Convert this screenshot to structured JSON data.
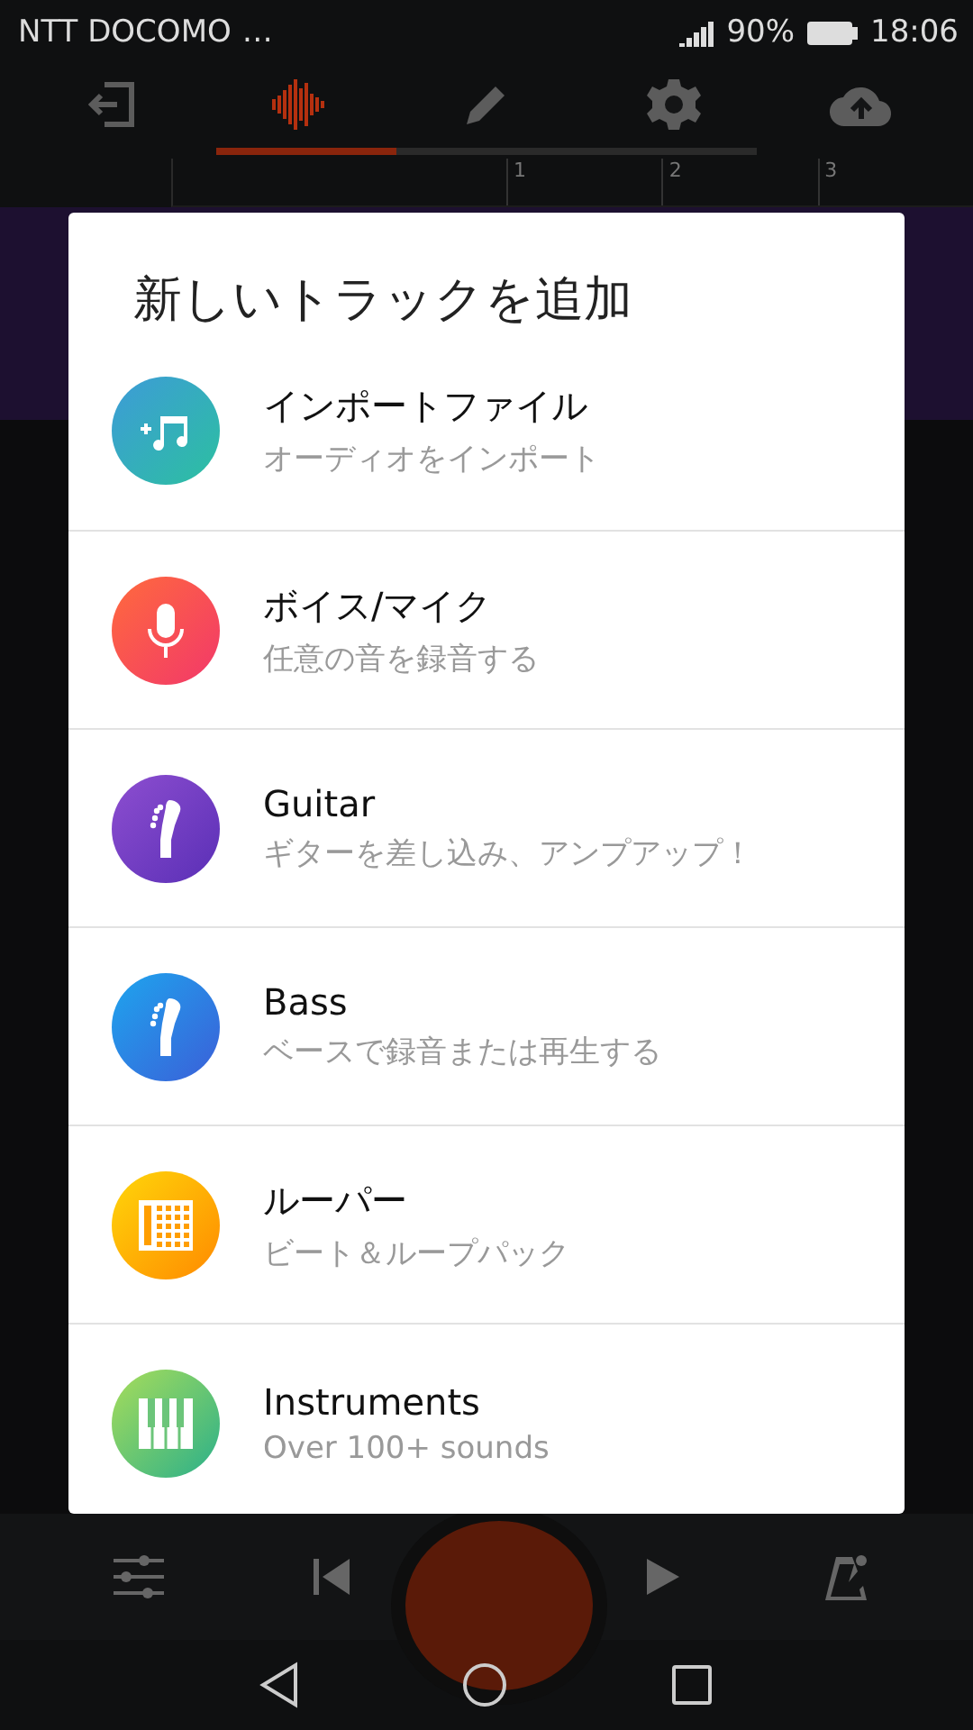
{
  "status_bar": {
    "carrier": "NTT DOCOMO",
    "more": "…",
    "battery": "90%",
    "time": "18:06"
  },
  "toolbar_tabs": [
    {
      "kind": "exit",
      "selected": false
    },
    {
      "kind": "studio",
      "selected": true
    },
    {
      "kind": "edit",
      "selected": false
    },
    {
      "kind": "settings",
      "selected": false
    },
    {
      "kind": "upload",
      "selected": false
    }
  ],
  "ruler": [
    "1",
    "2",
    "3"
  ],
  "dialog": {
    "title": "新しいトラックを追加",
    "items": [
      {
        "kind": "import",
        "title": "インポートファイル",
        "subtitle": "オーディオをインポート"
      },
      {
        "kind": "mic",
        "title": "ボイス/マイク",
        "subtitle": "任意の音を録音する"
      },
      {
        "kind": "guitar",
        "title": "Guitar",
        "subtitle": "ギターを差し込み、アンプアップ！"
      },
      {
        "kind": "bass",
        "title": "Bass",
        "subtitle": "ベースで録音または再生する"
      },
      {
        "kind": "looper",
        "title": "ルーパー",
        "subtitle": "ビート＆ループパック"
      },
      {
        "kind": "instruments",
        "title": "Instruments",
        "subtitle": "Over 100+ sounds"
      }
    ]
  }
}
